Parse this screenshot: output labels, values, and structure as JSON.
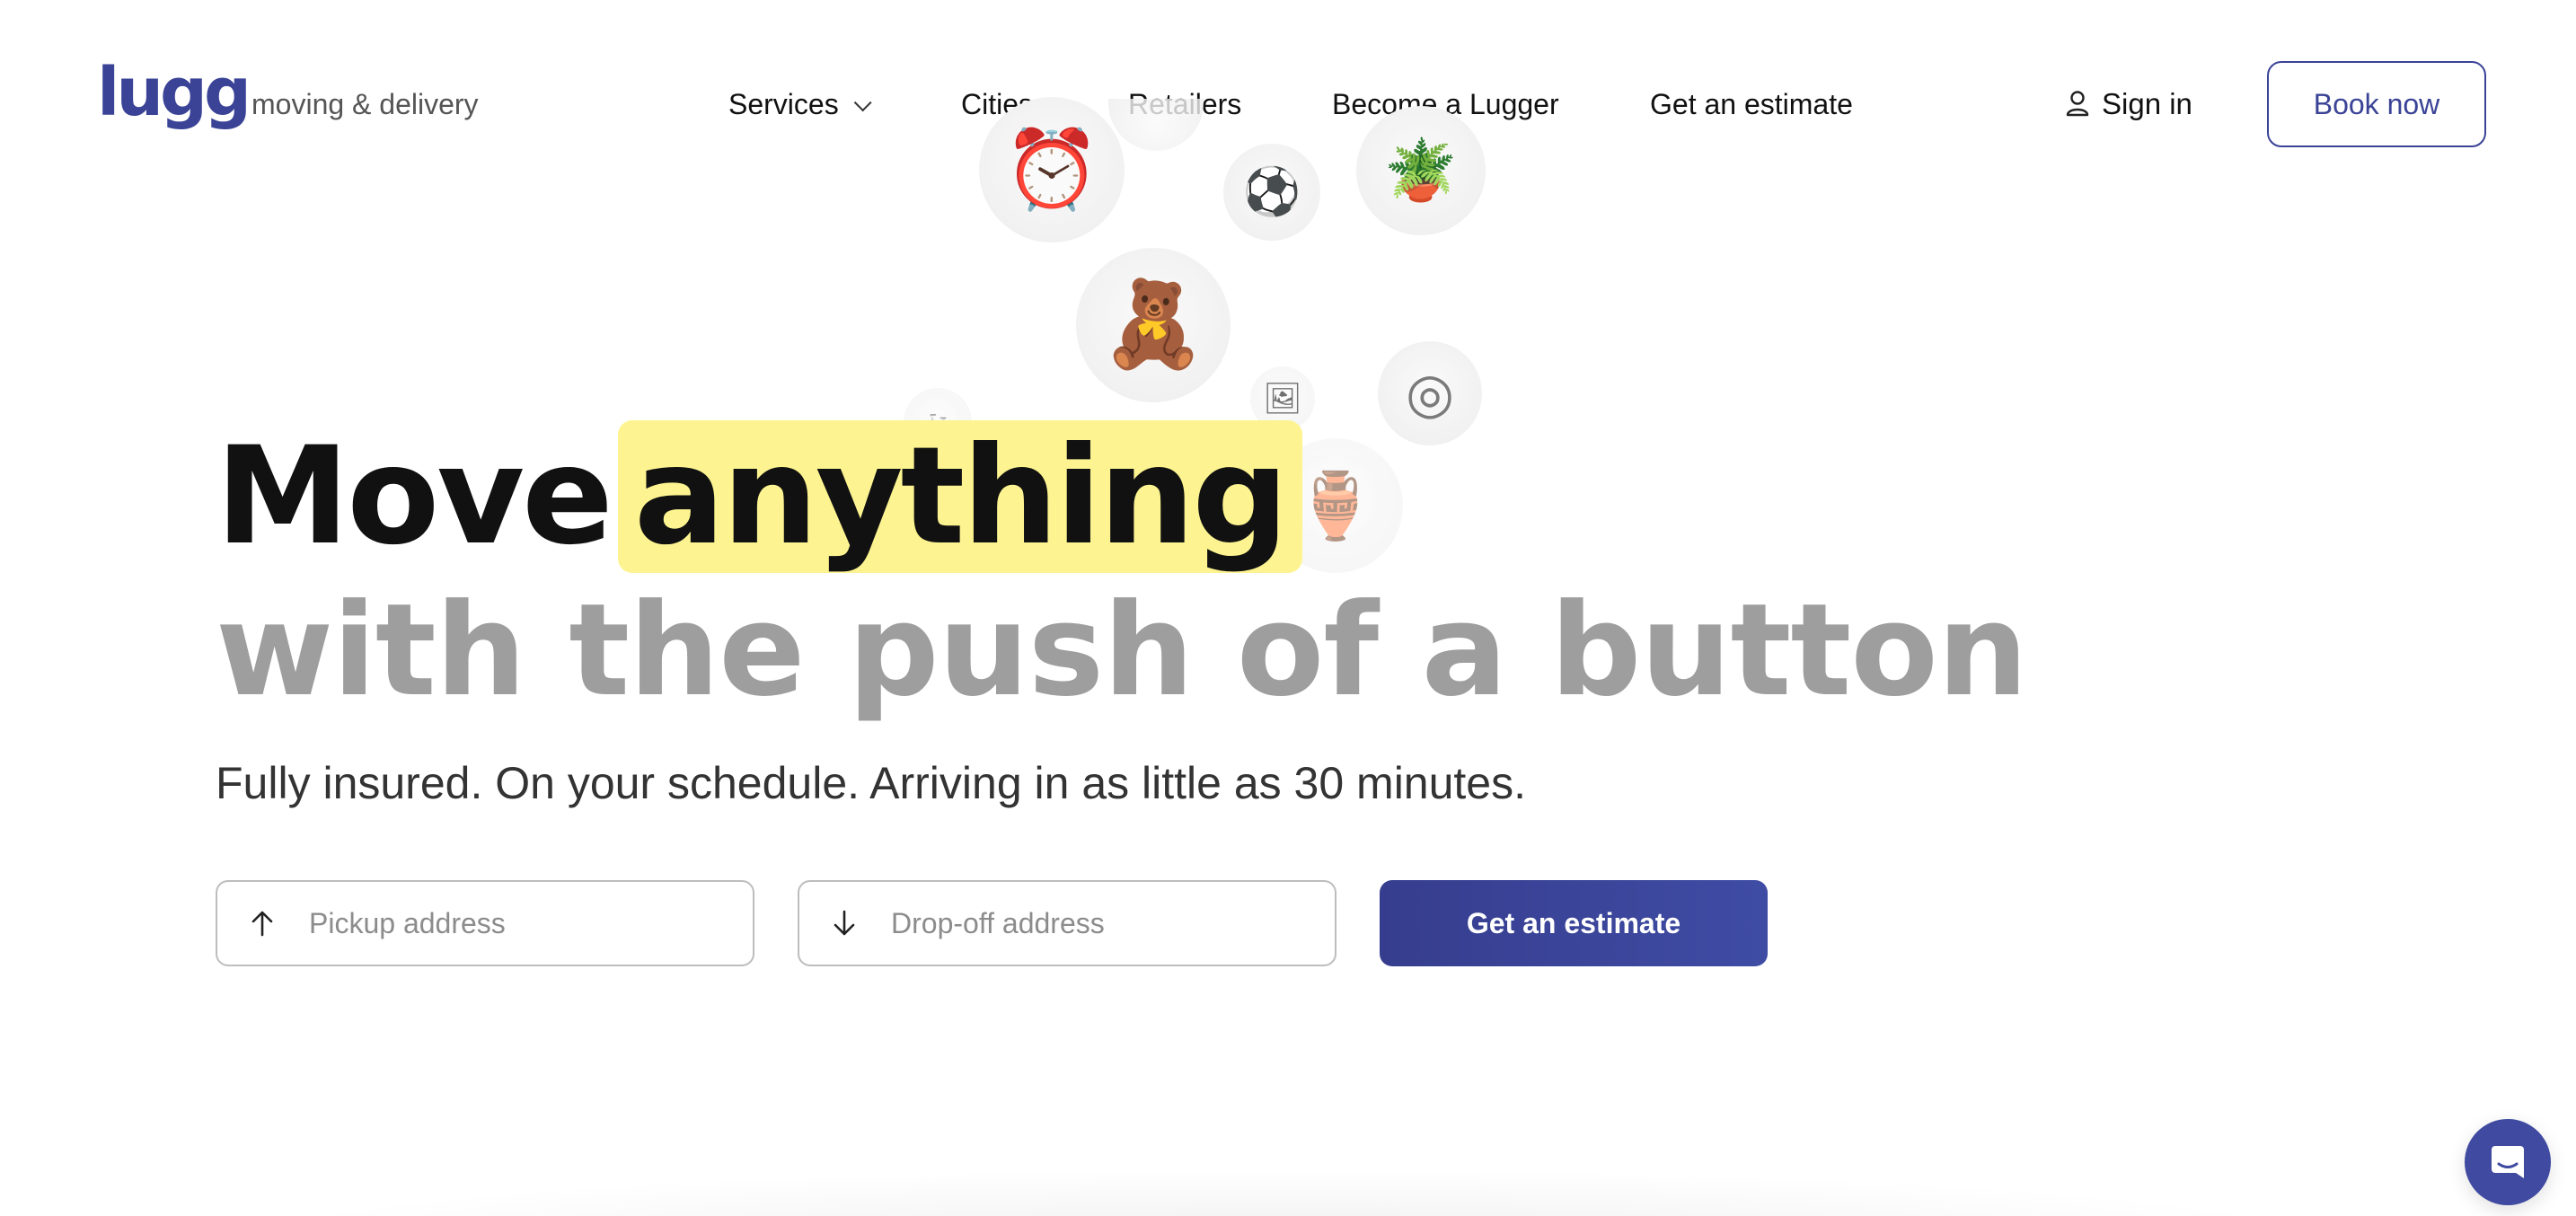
{
  "brand": {
    "logo_text": "lugg",
    "tagline": "moving & delivery",
    "color": "#3a4396"
  },
  "nav": {
    "items": [
      {
        "label": "Services",
        "has_dropdown": true
      },
      {
        "label": "Cities"
      },
      {
        "label": "Retailers"
      },
      {
        "label": "Become a Lugger"
      },
      {
        "label": "Get an estimate"
      }
    ],
    "sign_in": "Sign in",
    "sign_in_icon": "user-icon",
    "book_now": "Book now"
  },
  "floating_items": [
    {
      "name": "alarm-clock",
      "glyph": "⏰"
    },
    {
      "name": "soccer-ball",
      "glyph": "⚽"
    },
    {
      "name": "potted-plant",
      "glyph": "🪴"
    },
    {
      "name": "teddy-bear",
      "glyph": "🧸"
    },
    {
      "name": "bicycle",
      "glyph": "🚲"
    },
    {
      "name": "picture-frame",
      "glyph": "🖼"
    },
    {
      "name": "tire",
      "glyph": "◎"
    },
    {
      "name": "vase",
      "glyph": "🏺"
    }
  ],
  "hero": {
    "line1_prefix": "Move",
    "line1_highlight": "anything",
    "line2": "with the push of a button",
    "subline": "Fully insured. On your schedule. Arriving in as little as 30 minutes.",
    "highlight_color": "#fdf491"
  },
  "form": {
    "pickup_placeholder": "Pickup address",
    "pickup_value": "",
    "dropoff_placeholder": "Drop-off address",
    "dropoff_value": "",
    "submit_label": "Get an estimate",
    "pickup_icon": "arrow-up-icon",
    "dropoff_icon": "arrow-down-icon"
  },
  "chat": {
    "icon": "chat-icon",
    "color": "#3f4aa0"
  }
}
